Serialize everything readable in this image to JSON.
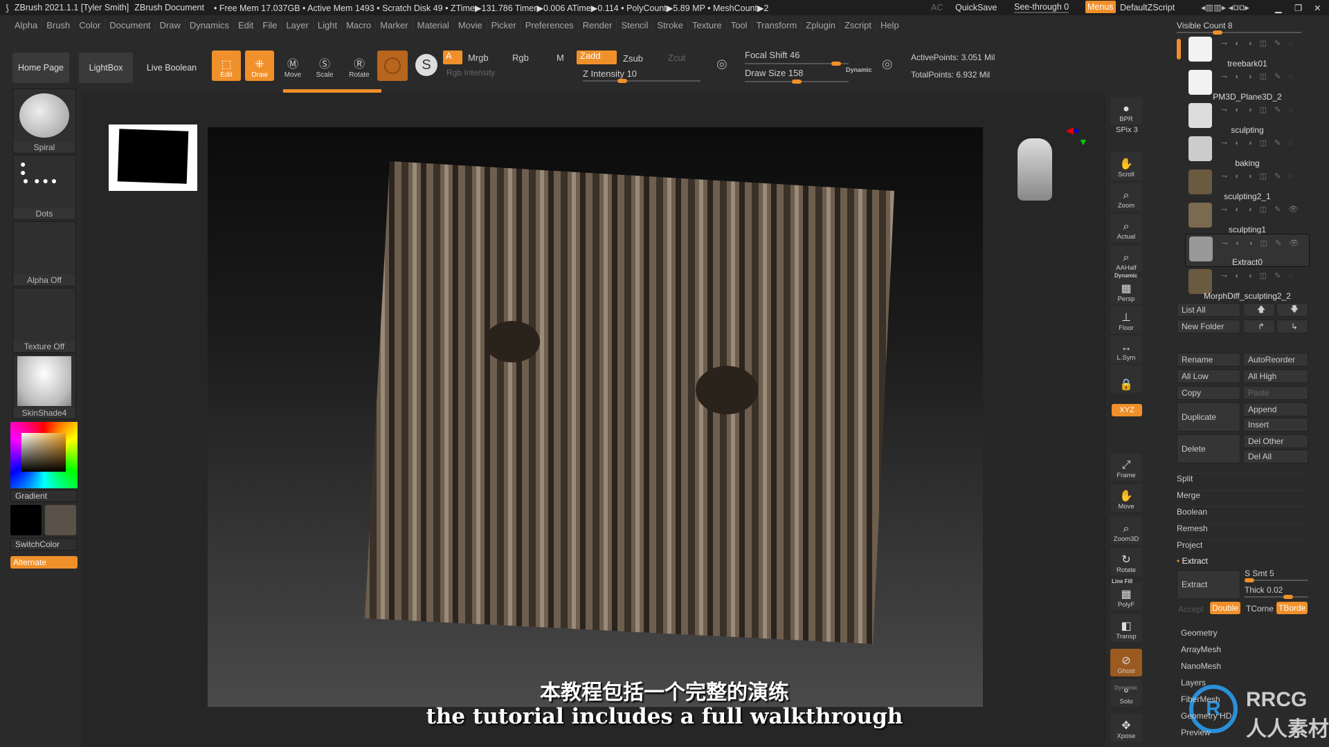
{
  "titlebar": {
    "app": "ZBrush 2021.1.1 [Tyler Smith]",
    "document": "ZBrush Document",
    "stats": "• Free Mem 17.037GB • Active Mem 1493 • Scratch Disk 49 • ZTime▶131.786 Timer▶0.006 ATime▶0.114 • PolyCount▶5.89 MP • MeshCount▶2",
    "ac": "AC",
    "quicksave": "QuickSave",
    "see_through": "See-through  0",
    "menus": "Menus",
    "default_zscript": "DefaultZScript"
  },
  "menu": [
    "Alpha",
    "Brush",
    "Color",
    "Document",
    "Draw",
    "Dynamics",
    "Edit",
    "File",
    "Layer",
    "Light",
    "Macro",
    "Marker",
    "Material",
    "Movie",
    "Picker",
    "Preferences",
    "Render",
    "Stencil",
    "Stroke",
    "Texture",
    "Tool",
    "Transform",
    "Zplugin",
    "Zscript",
    "Help"
  ],
  "toolbar": {
    "home": "Home Page",
    "lightbox": "LightBox",
    "live_boolean": "Live Boolean",
    "edit": "Edit",
    "draw": "Draw",
    "move": "Move",
    "scale": "Scale",
    "rotate": "Rotate",
    "a": "A",
    "mrgb": "Mrgb",
    "rgb": "Rgb",
    "m": "M",
    "rgb_intensity": "Rgb Intensity",
    "zadd": "Zadd",
    "zsub": "Zsub",
    "zcut": "Zcut",
    "z_intensity": "Z Intensity 10",
    "focal_shift": "Focal Shift 46",
    "draw_size": "Draw Size 158",
    "dynamic": "Dynamic",
    "active_points": "ActivePoints: 3.051 Mil",
    "total_points": "TotalPoints: 6.932 Mil",
    "progress": 0.12
  },
  "left": {
    "brush": "Spiral",
    "stroke": "Dots",
    "alpha": "Alpha Off",
    "texture": "Texture Off",
    "material": "SkinShade4",
    "gradient": "Gradient",
    "switch_color": "SwitchColor",
    "alternate": "Alternate",
    "main_color": "#000000",
    "secondary_color": "#5a5248"
  },
  "shelf": [
    {
      "label": "BPR",
      "icon": "bpr-sphere-icon",
      "glyph": "●"
    },
    {
      "label": "Scroll",
      "icon": "hand-scroll-icon",
      "glyph": "✋"
    },
    {
      "label": "Zoom",
      "icon": "zoom-icon",
      "glyph": "⌕"
    },
    {
      "label": "Actual",
      "icon": "actual-size-icon",
      "glyph": "⌕"
    },
    {
      "label": "AAHalf",
      "icon": "aahalf-icon",
      "glyph": "⌕"
    },
    {
      "label": "Persp",
      "icon": "perspective-icon",
      "glyph": "▦"
    },
    {
      "label": "Floor",
      "icon": "floor-icon",
      "glyph": "⊥"
    },
    {
      "label": "L.Sym",
      "icon": "local-symmetry-icon",
      "glyph": "↔"
    },
    {
      "label": "",
      "icon": "camera-lock-icon",
      "glyph": "🔒"
    },
    {
      "label": "Frame",
      "icon": "frame-icon",
      "glyph": "⤢"
    },
    {
      "label": "Move",
      "icon": "move-icon",
      "glyph": "✋"
    },
    {
      "label": "Zoom3D",
      "icon": "zoom3d-icon",
      "glyph": "⌕"
    },
    {
      "label": "Rotate",
      "icon": "rotate-icon",
      "glyph": "↻"
    },
    {
      "label": "PolyF",
      "icon": "polyframe-icon",
      "glyph": "▦"
    },
    {
      "label": "Transp",
      "icon": "transparency-icon",
      "glyph": "◧"
    },
    {
      "label": "Ghost",
      "icon": "ghost-icon",
      "glyph": "⊘"
    },
    {
      "label": "Solo",
      "icon": "solo-icon",
      "glyph": "⚬"
    },
    {
      "label": "Xpose",
      "icon": "xpose-icon",
      "glyph": "✥"
    }
  ],
  "shelf_extra": {
    "spix": "SPix 3",
    "xyz": "XYZ",
    "dynamic": "Dynamic",
    "line_fill": "Line Fill"
  },
  "subtool": {
    "visible_count": "Visible Count 8",
    "items": [
      "treebark01",
      "PM3D_Plane3D_2",
      "sculpting",
      "baking",
      "sculpting2_1",
      "sculpting1",
      "Extract0",
      "MorphDiff_sculpting2_2"
    ],
    "selected": 6,
    "list_all": "List All",
    "new_folder": "New Folder",
    "buttons": {
      "rename": "Rename",
      "autoreorder": "AutoReorder",
      "all_low": "All Low",
      "all_high": "All High",
      "copy": "Copy",
      "paste": "Paste",
      "duplicate": "Duplicate",
      "append": "Append",
      "insert": "Insert",
      "delete": "Delete",
      "del_other": "Del Other",
      "del_all": "Del All"
    },
    "sections": [
      "Split",
      "Merge",
      "Boolean",
      "Remesh",
      "Project"
    ],
    "extract": {
      "header": "Extract",
      "button": "Extract",
      "s_smt": "S Smt 5",
      "thick": "Thick 0.02",
      "accept": "Accept",
      "double": "Double",
      "tcorne": "TCorne",
      "tborde": "TBorde"
    },
    "palettes": [
      "Geometry",
      "ArrayMesh",
      "NanoMesh",
      "Layers",
      "FiberMesh",
      "Geometry HD",
      "Preview"
    ]
  },
  "subtitles": {
    "zh": "本教程包括一个完整的演练",
    "en": "the tutorial includes a full walkthrough"
  },
  "watermark": "RRCG 人人素材",
  "accent": "#f0902a"
}
